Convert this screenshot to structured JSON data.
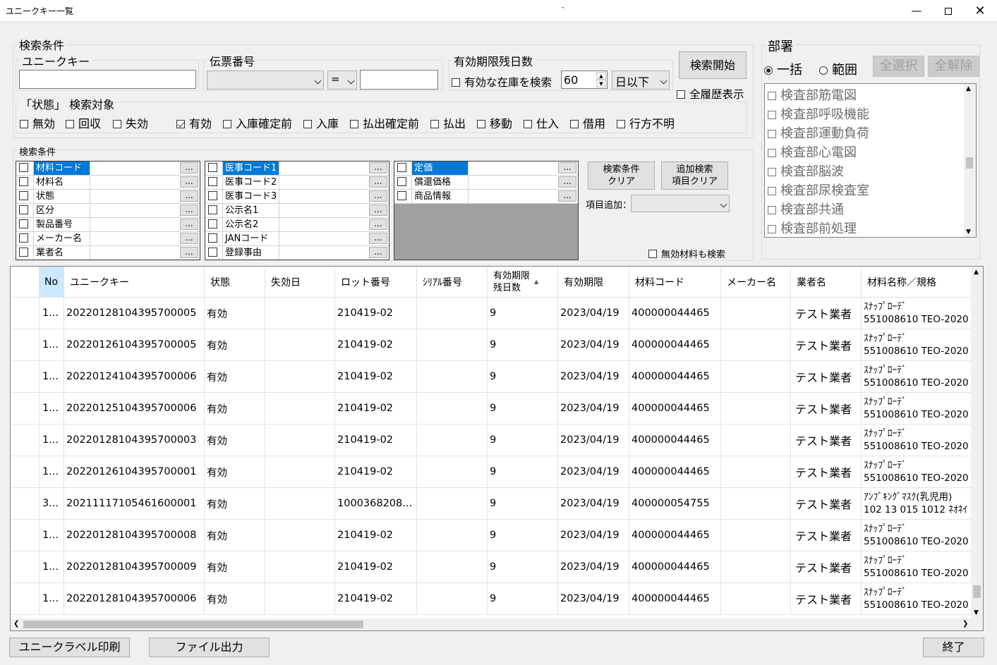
{
  "window": {
    "title": "ユニークキー一覧",
    "center_mark": "·"
  },
  "search": {
    "group_title": "検索条件",
    "unique_key": {
      "label": "ユニークキー",
      "value": ""
    },
    "voucher": {
      "label": "伝票番号",
      "select_value": "",
      "operator": "=",
      "value": ""
    },
    "expiry": {
      "label": "有効期限残日数",
      "checkbox_label": "有効な在庫を検索",
      "days": "60",
      "mode": "日以下"
    },
    "search_button": "検索開始",
    "all_history_label": "全履歴表示",
    "state_title": "「状態」 検索対象",
    "states": [
      {
        "label": "無効",
        "checked": false
      },
      {
        "label": "回収",
        "checked": false
      },
      {
        "label": "失効",
        "checked": false
      },
      {
        "label": "有効",
        "checked": true
      },
      {
        "label": "入庫確定前",
        "checked": false
      },
      {
        "label": "入庫",
        "checked": false
      },
      {
        "label": "払出確定前",
        "checked": false
      },
      {
        "label": "払出",
        "checked": false
      },
      {
        "label": "移動",
        "checked": false
      },
      {
        "label": "仕入",
        "checked": false
      },
      {
        "label": "借用",
        "checked": false
      },
      {
        "label": "行方不明",
        "checked": false
      }
    ]
  },
  "conditions": {
    "title": "検索条件",
    "list1": [
      "材料コード",
      "材料名",
      "状態",
      "区分",
      "製品番号",
      "メーカー名",
      "業者名"
    ],
    "list2": [
      "医事コード1",
      "医事コード2",
      "医事コード3",
      "公示名1",
      "公示名2",
      "JANコード",
      "登録事由"
    ],
    "list3": [
      "定価",
      "償還価格",
      "商品情報"
    ],
    "ellipsis": "...",
    "clear_button_l1": "検索条件",
    "clear_button_l2": "クリア",
    "item_clear_l1": "追加検索",
    "item_clear_l2": "項目クリア",
    "add_item_label": "項目追加：",
    "invalid_material_label": "無効材料も検索"
  },
  "dept": {
    "title": "部署",
    "radio_all": "一括",
    "radio_range": "範囲",
    "select_all": "全選択",
    "deselect_all": "全解除",
    "items": [
      "検査部筋電図",
      "検査部呼吸機能",
      "検査部運動負荷",
      "検査部心電図",
      "検査部脳波",
      "検査部尿検査室",
      "検査部共通",
      "検査部前処理"
    ]
  },
  "grid": {
    "columns": [
      "No",
      "ユニークキー",
      "状態",
      "失効日",
      "ロット番号",
      "ｼﾘｱﾙ番号",
      "有効期限残日数",
      "有効期限",
      "材料コード",
      "メーカー名",
      "業者名",
      "材料名称／規格"
    ],
    "expiry_col_l1": "有効期限",
    "expiry_col_l2": "残日数",
    "sort_indicator": "▲",
    "rows": [
      {
        "no": "1...",
        "key": "20220128104395700005",
        "state": "有効",
        "expire_date": "",
        "lot": "210419-02",
        "serial": "",
        "days": "9",
        "expiry": "2023/04/19",
        "code": "400000044465",
        "maker": "",
        "vendor": "テスト業者",
        "name1": "ｽﾅｯﾌﾟﾛｰﾃﾞ",
        "name2": "551008610 TEO-2020"
      },
      {
        "no": "1...",
        "key": "20220126104395700005",
        "state": "有効",
        "expire_date": "",
        "lot": "210419-02",
        "serial": "",
        "days": "9",
        "expiry": "2023/04/19",
        "code": "400000044465",
        "maker": "",
        "vendor": "テスト業者",
        "name1": "ｽﾅｯﾌﾟﾛｰﾃﾞ",
        "name2": "551008610 TEO-2020"
      },
      {
        "no": "1...",
        "key": "20220124104395700006",
        "state": "有効",
        "expire_date": "",
        "lot": "210419-02",
        "serial": "",
        "days": "9",
        "expiry": "2023/04/19",
        "code": "400000044465",
        "maker": "",
        "vendor": "テスト業者",
        "name1": "ｽﾅｯﾌﾟﾛｰﾃﾞ",
        "name2": "551008610 TEO-2020"
      },
      {
        "no": "1...",
        "key": "20220125104395700006",
        "state": "有効",
        "expire_date": "",
        "lot": "210419-02",
        "serial": "",
        "days": "9",
        "expiry": "2023/04/19",
        "code": "400000044465",
        "maker": "",
        "vendor": "テスト業者",
        "name1": "ｽﾅｯﾌﾟﾛｰﾃﾞ",
        "name2": "551008610 TEO-2020"
      },
      {
        "no": "1...",
        "key": "20220128104395700003",
        "state": "有効",
        "expire_date": "",
        "lot": "210419-02",
        "serial": "",
        "days": "9",
        "expiry": "2023/04/19",
        "code": "400000044465",
        "maker": "",
        "vendor": "テスト業者",
        "name1": "ｽﾅｯﾌﾟﾛｰﾃﾞ",
        "name2": "551008610 TEO-2020"
      },
      {
        "no": "1...",
        "key": "20220126104395700001",
        "state": "有効",
        "expire_date": "",
        "lot": "210419-02",
        "serial": "",
        "days": "9",
        "expiry": "2023/04/19",
        "code": "400000044465",
        "maker": "",
        "vendor": "テスト業者",
        "name1": "ｽﾅｯﾌﾟﾛｰﾃﾞ",
        "name2": "551008610 TEO-2020"
      },
      {
        "no": "3...",
        "key": "20211117105461600001",
        "state": "有効",
        "expire_date": "",
        "lot": "1000368208...",
        "serial": "",
        "days": "9",
        "expiry": "2023/04/19",
        "code": "400000054755",
        "maker": "",
        "vendor": "テスト業者",
        "name1": "ｱﾝﾌﾞｷﾝｸﾞﾏｽｸ(乳児用)",
        "name2": "102 13 015 1012 ﾈｵﾈｲ"
      },
      {
        "no": "1...",
        "key": "20220128104395700008",
        "state": "有効",
        "expire_date": "",
        "lot": "210419-02",
        "serial": "",
        "days": "9",
        "expiry": "2023/04/19",
        "code": "400000044465",
        "maker": "",
        "vendor": "テスト業者",
        "name1": "ｽﾅｯﾌﾟﾛｰﾃﾞ",
        "name2": "551008610 TEO-2020"
      },
      {
        "no": "1...",
        "key": "20220128104395700009",
        "state": "有効",
        "expire_date": "",
        "lot": "210419-02",
        "serial": "",
        "days": "9",
        "expiry": "2023/04/19",
        "code": "400000044465",
        "maker": "",
        "vendor": "テスト業者",
        "name1": "ｽﾅｯﾌﾟﾛｰﾃﾞ",
        "name2": "551008610 TEO-2020"
      },
      {
        "no": "1...",
        "key": "20220128104395700006",
        "state": "有効",
        "expire_date": "",
        "lot": "210419-02",
        "serial": "",
        "days": "9",
        "expiry": "2023/04/19",
        "code": "400000044465",
        "maker": "",
        "vendor": "テスト業者",
        "name1": "ｽﾅｯﾌﾟﾛｰﾃﾞ",
        "name2": "551008610 TEO-2020"
      }
    ]
  },
  "footer": {
    "print_button": "ユニークラベル印刷",
    "export_button": "ファイル出力",
    "close_button": "終了"
  }
}
